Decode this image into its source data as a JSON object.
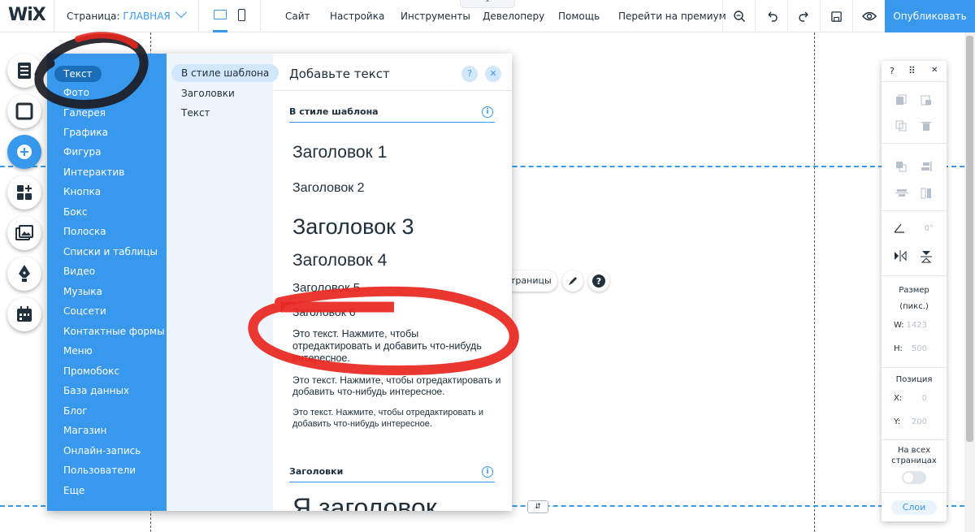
{
  "topbar": {
    "logo": "WiX",
    "page_label": "Страница:",
    "page_name": "ГЛАВНАЯ",
    "menu": [
      "Сайт",
      "Настройка",
      "Инструменты",
      "Девелоперу",
      "Помощь",
      "Перейти на премиум"
    ],
    "publish_label": "Опубликовать",
    "collapse_glyph": "⌃"
  },
  "left_tools": [
    "menus-pages-icon",
    "background-icon",
    "add-icon",
    "apps-icon",
    "media-icon",
    "blog-pen-icon",
    "bookings-icon"
  ],
  "add_panel": {
    "categories": [
      "Текст",
      "Фото",
      "Галерея",
      "Графика",
      "Фигура",
      "Интерактив",
      "Кнопка",
      "Бокс",
      "Полоска",
      "Списки и таблицы",
      "Видео",
      "Музыка",
      "Соцсети",
      "Контактные формы",
      "Меню",
      "Промобокс",
      "База данных",
      "Блог",
      "Магазин",
      "Онлайн-запись",
      "Пользователи",
      "Еще"
    ],
    "subcategories": [
      "В стиле шаблона",
      "Заголовки",
      "Текст"
    ],
    "title": "Добавьте текст",
    "help_glyph": "?",
    "close_glyph": "✕",
    "section_theme": "В стиле шаблона",
    "section_headings": "Заголовки",
    "info_glyph": "i",
    "headings": [
      "Заголовок 1",
      "Заголовок 2",
      "Заголовок 3",
      "Заголовок 4",
      "Заголовок 5",
      "Заголовок 6"
    ],
    "paragraphs": [
      "Это текст. Нажмите, чтобы отредактировать и добавить что-нибудь интересное.",
      "Это текст. Нажмите, чтобы отредактировать и добавить что-нибудь интересное.",
      "Это текст. Нажмите, чтобы отредактировать и добавить что-нибудь интересное."
    ],
    "heading_preview": "Я заголовок"
  },
  "canvas": {
    "context_label": "траницы",
    "handle_glyph": "⇵"
  },
  "right_panel": {
    "help_glyph": "?",
    "drag_glyph": "⠿",
    "close_glyph": "✕",
    "size_label": "Размер",
    "size_unit": "(пикс.)",
    "w_label": "W:",
    "w_value": "1423",
    "h_label": "H:",
    "h_value": "500",
    "position_label": "Позиция",
    "x_label": "X:",
    "x_value": "0",
    "y_label": "Y:",
    "y_value": "200",
    "rotation_value": "0°",
    "all_pages_label": "На всех страницах",
    "layers_label": "Слои"
  },
  "annotation_colors": {
    "dark_circle": "#1c1c24",
    "red_circle": "#e8271f"
  },
  "colors": {
    "accent": "#3899ec",
    "dark_text": "#20303c"
  }
}
